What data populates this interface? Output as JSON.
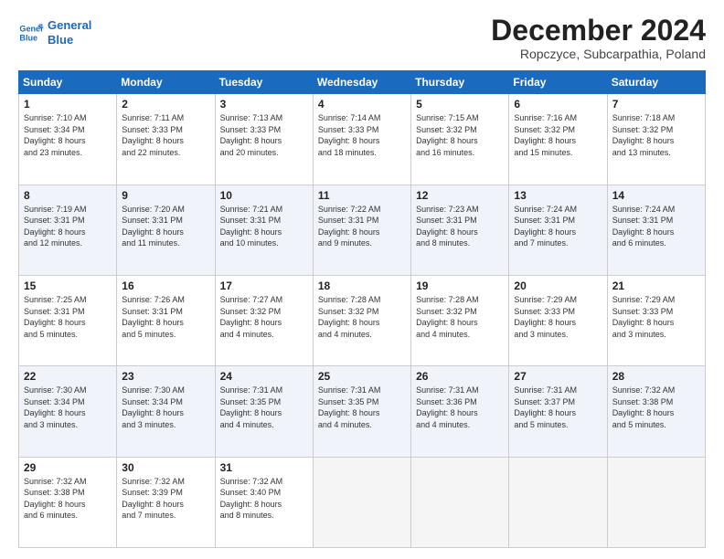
{
  "logo": {
    "line1": "General",
    "line2": "Blue"
  },
  "title": "December 2024",
  "subtitle": "Ropczyce, Subcarpathia, Poland",
  "days_of_week": [
    "Sunday",
    "Monday",
    "Tuesday",
    "Wednesday",
    "Thursday",
    "Friday",
    "Saturday"
  ],
  "weeks": [
    [
      {
        "day": "1",
        "sunrise": "7:10 AM",
        "sunset": "3:34 PM",
        "daylight_h": "8",
        "daylight_m": "23"
      },
      {
        "day": "2",
        "sunrise": "7:11 AM",
        "sunset": "3:33 PM",
        "daylight_h": "8",
        "daylight_m": "22"
      },
      {
        "day": "3",
        "sunrise": "7:13 AM",
        "sunset": "3:33 PM",
        "daylight_h": "8",
        "daylight_m": "20"
      },
      {
        "day": "4",
        "sunrise": "7:14 AM",
        "sunset": "3:33 PM",
        "daylight_h": "8",
        "daylight_m": "18"
      },
      {
        "day": "5",
        "sunrise": "7:15 AM",
        "sunset": "3:32 PM",
        "daylight_h": "8",
        "daylight_m": "16"
      },
      {
        "day": "6",
        "sunrise": "7:16 AM",
        "sunset": "3:32 PM",
        "daylight_h": "8",
        "daylight_m": "15"
      },
      {
        "day": "7",
        "sunrise": "7:18 AM",
        "sunset": "3:32 PM",
        "daylight_h": "8",
        "daylight_m": "13"
      }
    ],
    [
      {
        "day": "8",
        "sunrise": "7:19 AM",
        "sunset": "3:31 PM",
        "daylight_h": "8",
        "daylight_m": "12"
      },
      {
        "day": "9",
        "sunrise": "7:20 AM",
        "sunset": "3:31 PM",
        "daylight_h": "8",
        "daylight_m": "11"
      },
      {
        "day": "10",
        "sunrise": "7:21 AM",
        "sunset": "3:31 PM",
        "daylight_h": "8",
        "daylight_m": "10"
      },
      {
        "day": "11",
        "sunrise": "7:22 AM",
        "sunset": "3:31 PM",
        "daylight_h": "8",
        "daylight_m": "9"
      },
      {
        "day": "12",
        "sunrise": "7:23 AM",
        "sunset": "3:31 PM",
        "daylight_h": "8",
        "daylight_m": "8"
      },
      {
        "day": "13",
        "sunrise": "7:24 AM",
        "sunset": "3:31 PM",
        "daylight_h": "8",
        "daylight_m": "7"
      },
      {
        "day": "14",
        "sunrise": "7:24 AM",
        "sunset": "3:31 PM",
        "daylight_h": "8",
        "daylight_m": "6"
      }
    ],
    [
      {
        "day": "15",
        "sunrise": "7:25 AM",
        "sunset": "3:31 PM",
        "daylight_h": "8",
        "daylight_m": "5"
      },
      {
        "day": "16",
        "sunrise": "7:26 AM",
        "sunset": "3:31 PM",
        "daylight_h": "8",
        "daylight_m": "5"
      },
      {
        "day": "17",
        "sunrise": "7:27 AM",
        "sunset": "3:32 PM",
        "daylight_h": "8",
        "daylight_m": "4"
      },
      {
        "day": "18",
        "sunrise": "7:28 AM",
        "sunset": "3:32 PM",
        "daylight_h": "8",
        "daylight_m": "4"
      },
      {
        "day": "19",
        "sunrise": "7:28 AM",
        "sunset": "3:32 PM",
        "daylight_h": "8",
        "daylight_m": "4"
      },
      {
        "day": "20",
        "sunrise": "7:29 AM",
        "sunset": "3:33 PM",
        "daylight_h": "8",
        "daylight_m": "3"
      },
      {
        "day": "21",
        "sunrise": "7:29 AM",
        "sunset": "3:33 PM",
        "daylight_h": "8",
        "daylight_m": "3"
      }
    ],
    [
      {
        "day": "22",
        "sunrise": "7:30 AM",
        "sunset": "3:34 PM",
        "daylight_h": "8",
        "daylight_m": "3"
      },
      {
        "day": "23",
        "sunrise": "7:30 AM",
        "sunset": "3:34 PM",
        "daylight_h": "8",
        "daylight_m": "3"
      },
      {
        "day": "24",
        "sunrise": "7:31 AM",
        "sunset": "3:35 PM",
        "daylight_h": "8",
        "daylight_m": "4"
      },
      {
        "day": "25",
        "sunrise": "7:31 AM",
        "sunset": "3:35 PM",
        "daylight_h": "8",
        "daylight_m": "4"
      },
      {
        "day": "26",
        "sunrise": "7:31 AM",
        "sunset": "3:36 PM",
        "daylight_h": "8",
        "daylight_m": "4"
      },
      {
        "day": "27",
        "sunrise": "7:31 AM",
        "sunset": "3:37 PM",
        "daylight_h": "8",
        "daylight_m": "5"
      },
      {
        "day": "28",
        "sunrise": "7:32 AM",
        "sunset": "3:38 PM",
        "daylight_h": "8",
        "daylight_m": "5"
      }
    ],
    [
      {
        "day": "29",
        "sunrise": "7:32 AM",
        "sunset": "3:38 PM",
        "daylight_h": "8",
        "daylight_m": "6"
      },
      {
        "day": "30",
        "sunrise": "7:32 AM",
        "sunset": "3:39 PM",
        "daylight_h": "8",
        "daylight_m": "7"
      },
      {
        "day": "31",
        "sunrise": "7:32 AM",
        "sunset": "3:40 PM",
        "daylight_h": "8",
        "daylight_m": "8"
      },
      null,
      null,
      null,
      null
    ]
  ]
}
